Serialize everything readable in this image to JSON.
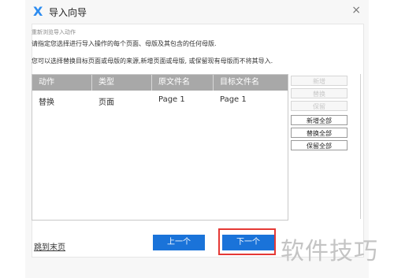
{
  "window": {
    "logo_glyph": "X",
    "title": "导入向导",
    "close_glyph": "×"
  },
  "content": {
    "subtitle": "重新浏览导入动作",
    "instruction1": "请指定您选择进行导入操作的每个页面、母版及其包含的任何母版.",
    "instruction2": "您可以选择替换目标页面或母版的来源,新增页面或母版, 或保留现有母版而不将其导入."
  },
  "table": {
    "columns": [
      "动作",
      "类型",
      "原文件名",
      "目标文件名"
    ],
    "rows": [
      [
        "替换",
        "页面",
        "Page 1",
        "Page 1"
      ]
    ]
  },
  "side_buttons": [
    {
      "label": "新增",
      "enabled": false
    },
    {
      "label": "替换",
      "enabled": false
    },
    {
      "label": "保留",
      "enabled": false
    },
    {
      "label": "新增全部",
      "enabled": true
    },
    {
      "label": "替换全部",
      "enabled": true
    },
    {
      "label": "保留全部",
      "enabled": true
    }
  ],
  "footer": {
    "jump_link": "跳到末页",
    "prev_button": "上一个",
    "next_button": "下一个"
  },
  "watermark": "软件技巧",
  "colors": {
    "accent": "#1a73d9",
    "highlight": "#e53935",
    "header_bg": "#a8a8a8"
  }
}
